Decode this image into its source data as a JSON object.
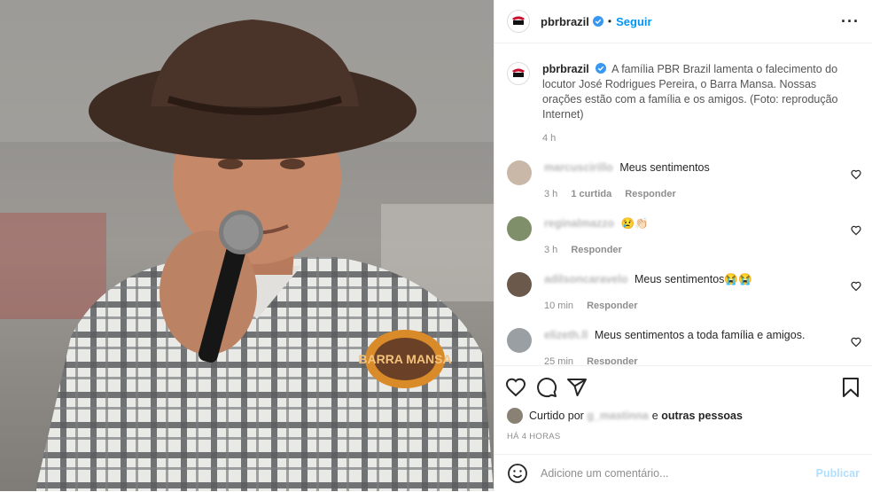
{
  "header": {
    "username": "pbrbrazil",
    "follow_label": "Seguir",
    "dot": "•",
    "more": "···"
  },
  "caption": {
    "username": "pbrbrazil",
    "text": "A família PBR Brazil lamenta o falecimento do locutor José Rodrigues Pereira, o Barra Mansa. Nossas orações estão com a família e os amigos. (Foto: reprodução Internet)",
    "time": "4 h"
  },
  "comments": [
    {
      "user": "marcuscirillo",
      "text": "Meus sentimentos",
      "time": "3 h",
      "likes": "1 curtida",
      "reply": "Responder",
      "avatar_color": "#c9b7a8"
    },
    {
      "user": "reginalmazzo",
      "text": "😢👏🏻",
      "time": "3 h",
      "likes": "",
      "reply": "Responder",
      "avatar_color": "#7f8f6a"
    },
    {
      "user": "adilsoncaravelo",
      "text": "Meus sentimentos😭😭",
      "time": "10 min",
      "likes": "",
      "reply": "Responder",
      "avatar_color": "#6b5a4c"
    },
    {
      "user": "elizeth.ll",
      "text": "Meus sentimentos a toda família e amigos.",
      "time": "25 min",
      "likes": "",
      "reply": "Responder",
      "avatar_color": "#9a9fa3"
    }
  ],
  "likes": {
    "prefix": "Curtido por",
    "user": "g_mastinna",
    "suffix_and": "e",
    "others": "outras pessoas"
  },
  "posted_ago": "HÁ 4 HORAS",
  "add_comment": {
    "placeholder": "Adicione um comentário...",
    "publish": "Publicar"
  },
  "photo": {
    "shirt_patch": "BARRA MANSA"
  }
}
